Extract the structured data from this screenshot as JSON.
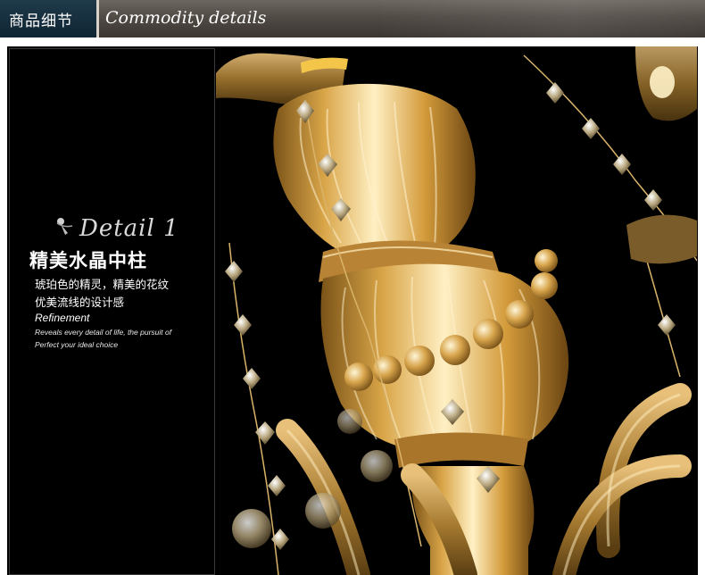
{
  "header": {
    "title_cn": "商品细节",
    "title_en": "Commodity details"
  },
  "detail": {
    "badge_label": "Detail 1",
    "title_cn": "精美水晶中柱",
    "subtitle_lines": [
      "琥珀色的精灵，精美的花纹",
      "优美流线的设计感"
    ],
    "feature_title": "Refinement",
    "feature_desc_lines": [
      "Reveals every detail of life, the pursuit of",
      "Perfect your ideal choice"
    ]
  },
  "photo": {
    "subject": "amber crystal chandelier center column",
    "colors": {
      "amber": "#d9a548",
      "gold": "#c8952a",
      "highlight": "#fff4cf",
      "crystal": "#9a8a6a"
    }
  },
  "colors": {
    "header_left_bg": "#16303f",
    "header_bg": "#514b46",
    "panel_bg": "#000000",
    "text": "#ffffff"
  }
}
